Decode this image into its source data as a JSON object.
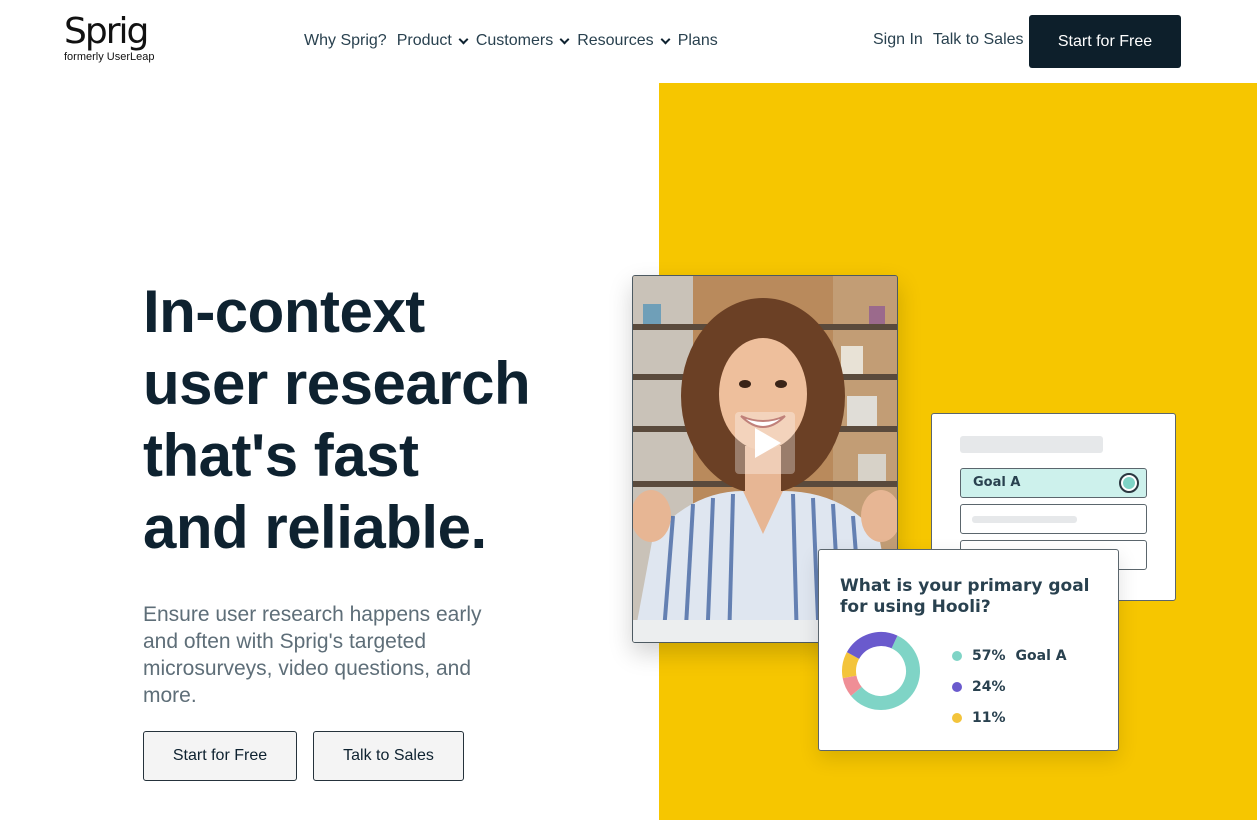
{
  "brand": {
    "name": "Sprig",
    "tagline": "formerly UserLeap"
  },
  "nav": {
    "items": [
      {
        "label": "Why Sprig?",
        "has_dropdown": false
      },
      {
        "label": "Product",
        "has_dropdown": true
      },
      {
        "label": "Customers",
        "has_dropdown": true
      },
      {
        "label": "Resources",
        "has_dropdown": true
      },
      {
        "label": "Plans",
        "has_dropdown": false
      }
    ],
    "sign_in": "Sign In",
    "talk_to_sales": "Talk to Sales",
    "cta": "Start for Free"
  },
  "hero": {
    "headline_lines": [
      "In-context",
      "user research",
      "that's fast",
      "and reliable."
    ],
    "subtext": "Ensure user research happens early and often with Sprig's targeted microsurveys, video questions, and more.",
    "primary_button": "Start for Free",
    "secondary_button": "Talk to Sales"
  },
  "illustration": {
    "video_icon": "play-icon",
    "goal_option": "Goal A",
    "poll": {
      "question": "What is your primary goal for using Hooli?",
      "results": [
        {
          "percent": "57%",
          "label": "Goal A",
          "color": "#7fd4c6",
          "value": 57
        },
        {
          "percent": "24%",
          "label": "",
          "color": "#6a5acd",
          "value": 24
        },
        {
          "percent": "11%",
          "label": "",
          "color": "#f3c43b",
          "value": 11
        }
      ],
      "extra_segment_color": "#ef8e96",
      "extra_segment_value": 8
    }
  },
  "colors": {
    "accent_yellow": "#f6c600",
    "dark_navy": "#0d1f2b",
    "text": "#0e2230",
    "muted": "#5e6e78"
  }
}
